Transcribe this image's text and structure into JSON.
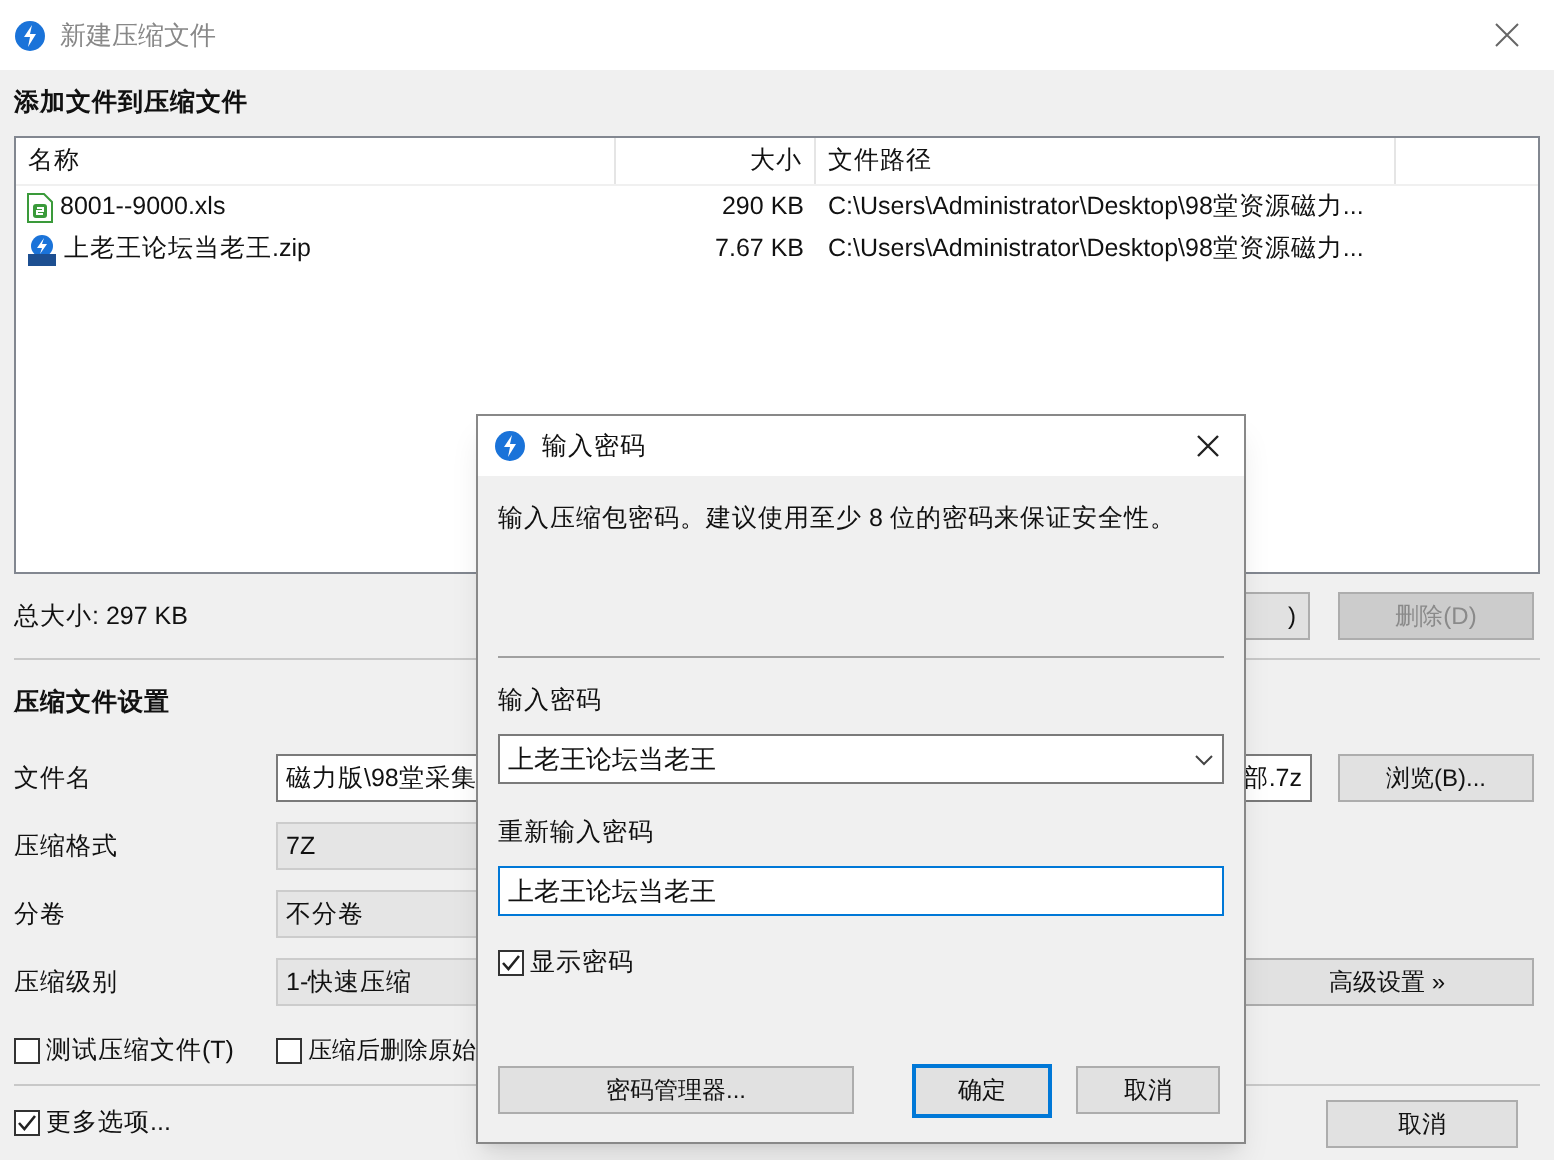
{
  "window": {
    "title": "新建压缩文件"
  },
  "add_section": {
    "heading": "添加文件到压缩文件",
    "table": {
      "columns": [
        "名称",
        "大小",
        "文件路径"
      ],
      "rows": [
        {
          "kind": "sheet",
          "name": "8001--9000.xls",
          "size": "290 KB",
          "path": "C:\\Users\\Administrator\\Desktop\\98堂资源磁力..."
        },
        {
          "kind": "archive",
          "name": "上老王论坛当老王.zip",
          "size": "7.67 KB",
          "path": "C:\\Users\\Administrator\\Desktop\\98堂资源磁力..."
        }
      ]
    },
    "total_size": "总大小: 297 KB",
    "buttons": [
      {
        "label": ")",
        "disabled": false
      },
      {
        "label": "删除(D)",
        "disabled": true
      }
    ]
  },
  "settings": {
    "heading": "压缩文件设置",
    "fields": [
      {
        "kind": "text",
        "label": "文件名",
        "value_start": "磁力版\\98堂采集",
        "value_end": "部.7z"
      },
      {
        "kind": "select",
        "label": "压缩格式",
        "value": "7Z"
      },
      {
        "kind": "select",
        "label": "分卷",
        "value": "不分卷"
      },
      {
        "kind": "select",
        "label": "压缩级别",
        "value": "1-快速压缩"
      }
    ],
    "browse_button": "浏览(B)...",
    "advanced_button": "高级设置 »",
    "options": [
      {
        "label": "测试压缩文件(T)",
        "checked": false
      },
      {
        "label": "压缩后删除原始",
        "checked": false
      }
    ],
    "more_options": {
      "label": "更多选项...",
      "checked": true
    },
    "cancel_button": "取消"
  },
  "dialog": {
    "title": "输入密码",
    "message": "输入压缩包密码。建议使用至少 8 位的密码来保证安全性。",
    "password_label": "输入密码",
    "password_value": "上老王论坛当老王",
    "confirm_label": "重新输入密码",
    "confirm_value": "上老王论坛当老王",
    "show_password": {
      "label": "显示密码",
      "checked": true
    },
    "buttons": [
      {
        "label": "密码管理器...",
        "default": false
      },
      {
        "label": "确定",
        "default": true
      },
      {
        "label": "取消",
        "default": false
      }
    ]
  }
}
